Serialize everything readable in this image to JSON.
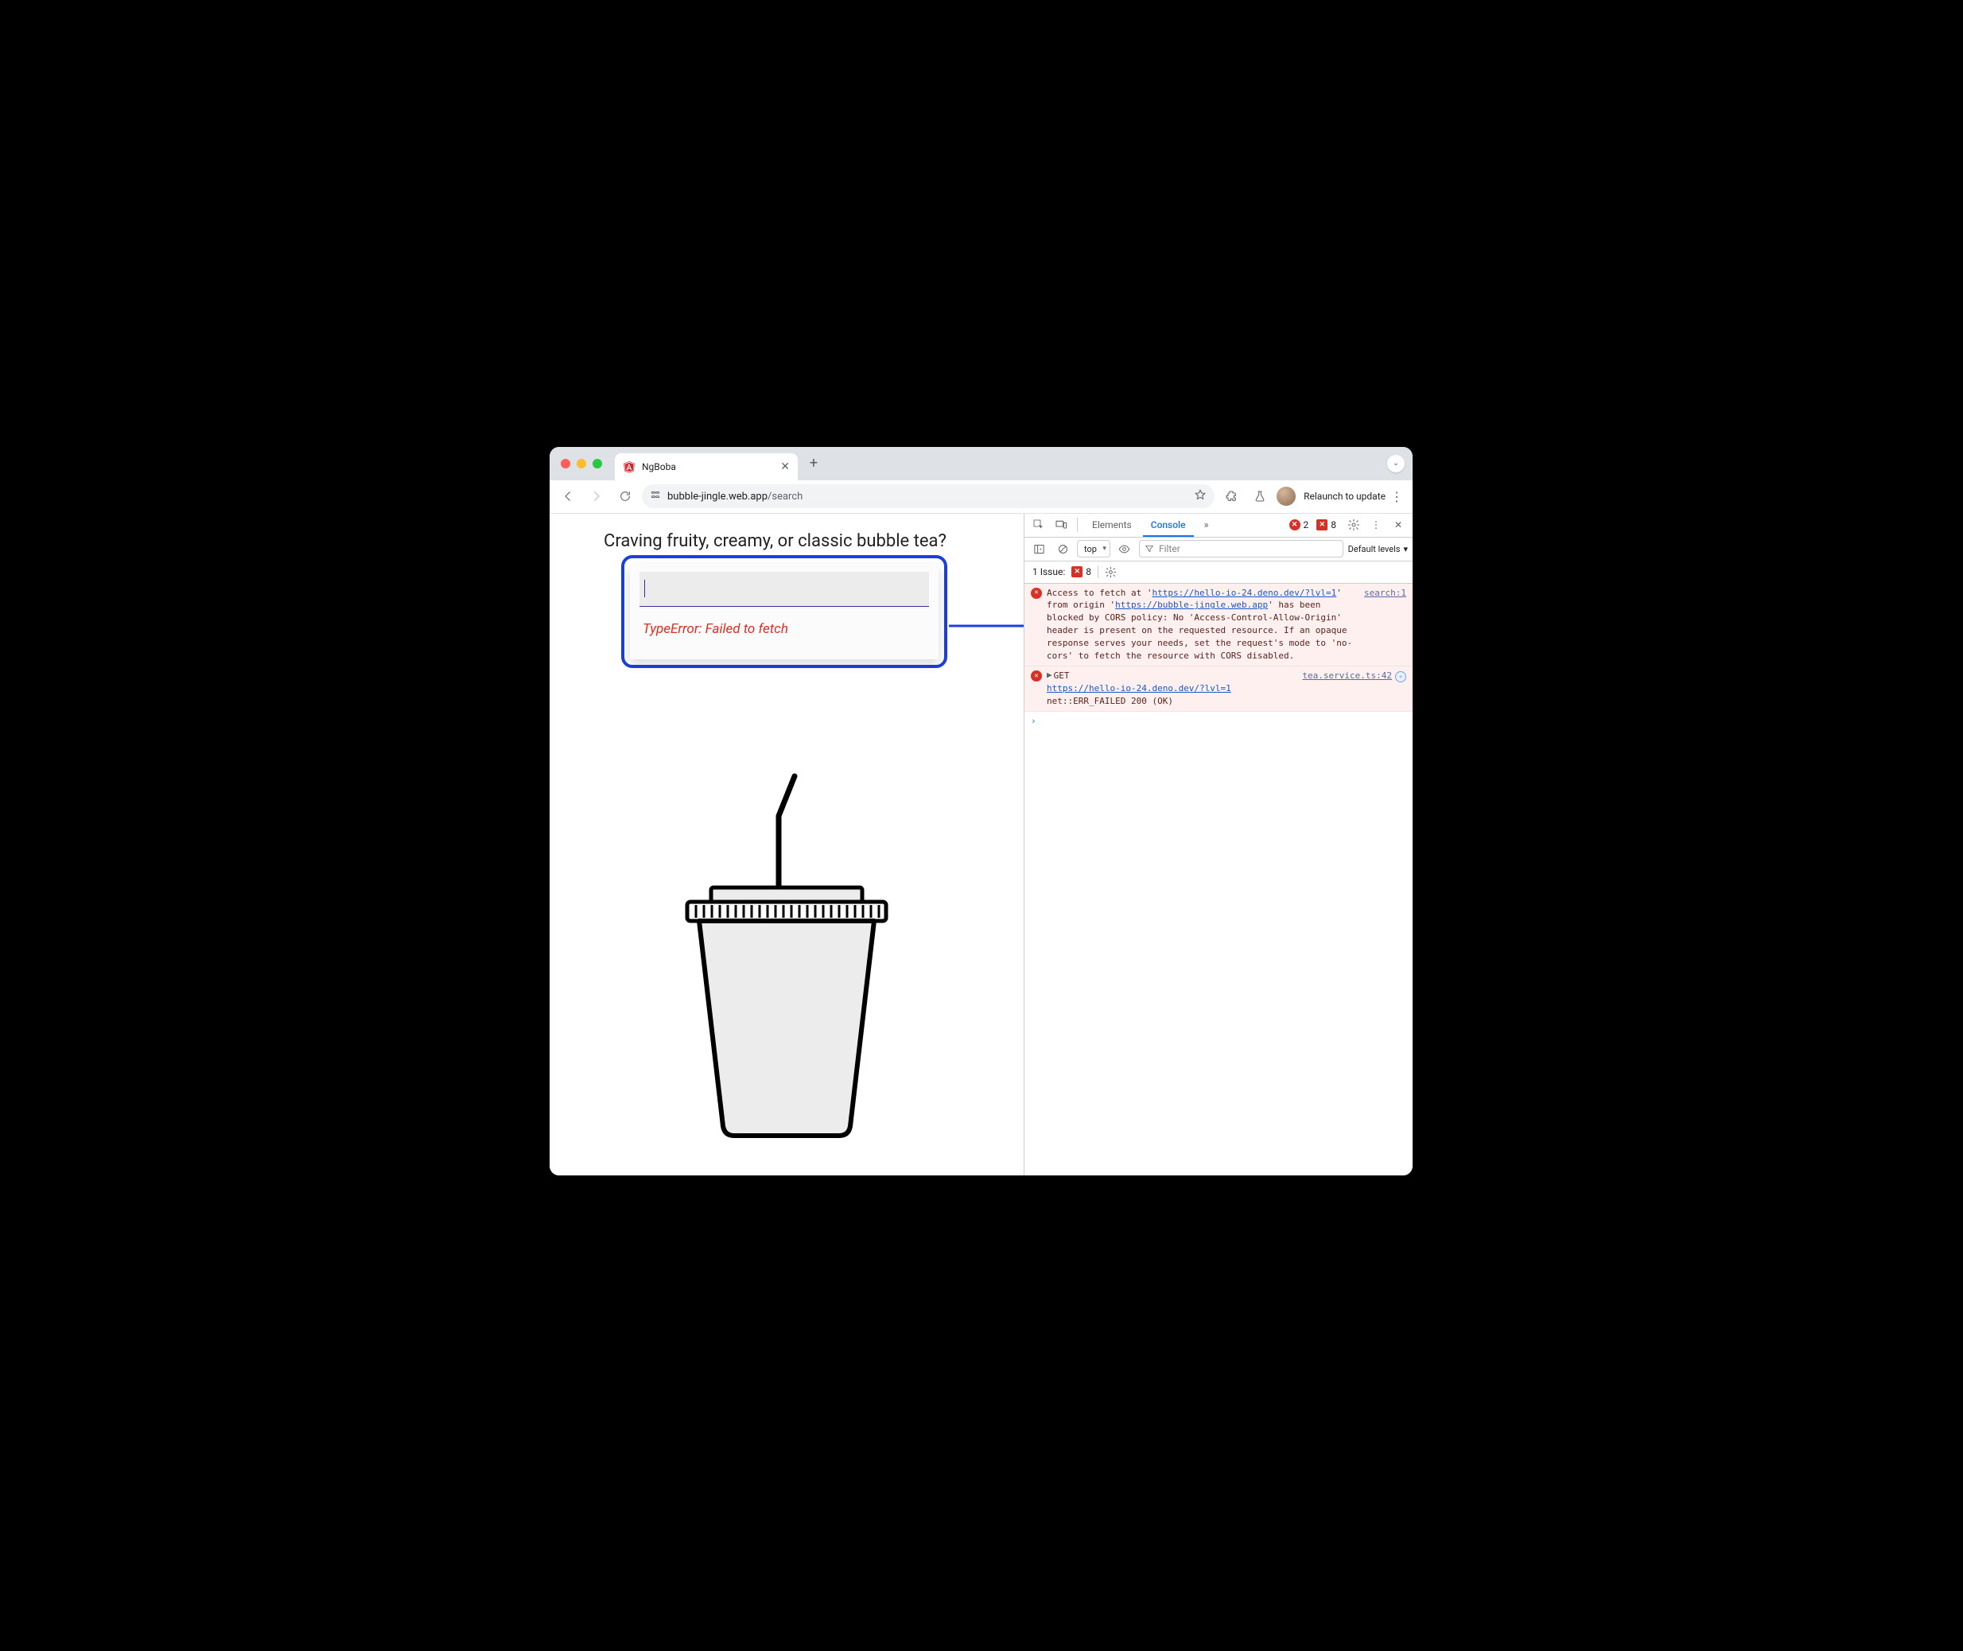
{
  "browser": {
    "tab_title": "NgBoba",
    "url_host": "bubble-jingle.web.app",
    "url_path": "/search",
    "relaunch_label": "Relaunch to update"
  },
  "page": {
    "heading": "Craving fruity, creamy, or classic bubble tea?",
    "search_value": "",
    "error_message": "TypeError: Failed to fetch"
  },
  "devtools": {
    "tabs": {
      "elements": "Elements",
      "console": "Console"
    },
    "error_count": "2",
    "issue_count": "8",
    "context": "top",
    "filter_placeholder": "Filter",
    "levels_label": "Default levels",
    "issues_label": "1 Issue:",
    "issues_badge_count": "8",
    "logs": [
      {
        "type": "error",
        "source": "search:1",
        "pre": "Access to fetch at '",
        "link1": "https://hello-io-24.deno.dev/?lvl=1",
        "mid": "' from origin '",
        "link2": "https://bubble-jingle.web.app",
        "post": "' has been blocked by CORS policy: No 'Access-Control-Allow-Origin' header is present on the requested resource. If an opaque response serves your needs, set the request's mode to 'no-cors' to fetch the resource with CORS disabled."
      },
      {
        "type": "error",
        "source": "tea.service.ts:42",
        "method": "GET",
        "url": "https://hello-io-24.deno.dev/?lvl=1",
        "tail": " net::ERR_FAILED 200 (OK)"
      }
    ]
  }
}
